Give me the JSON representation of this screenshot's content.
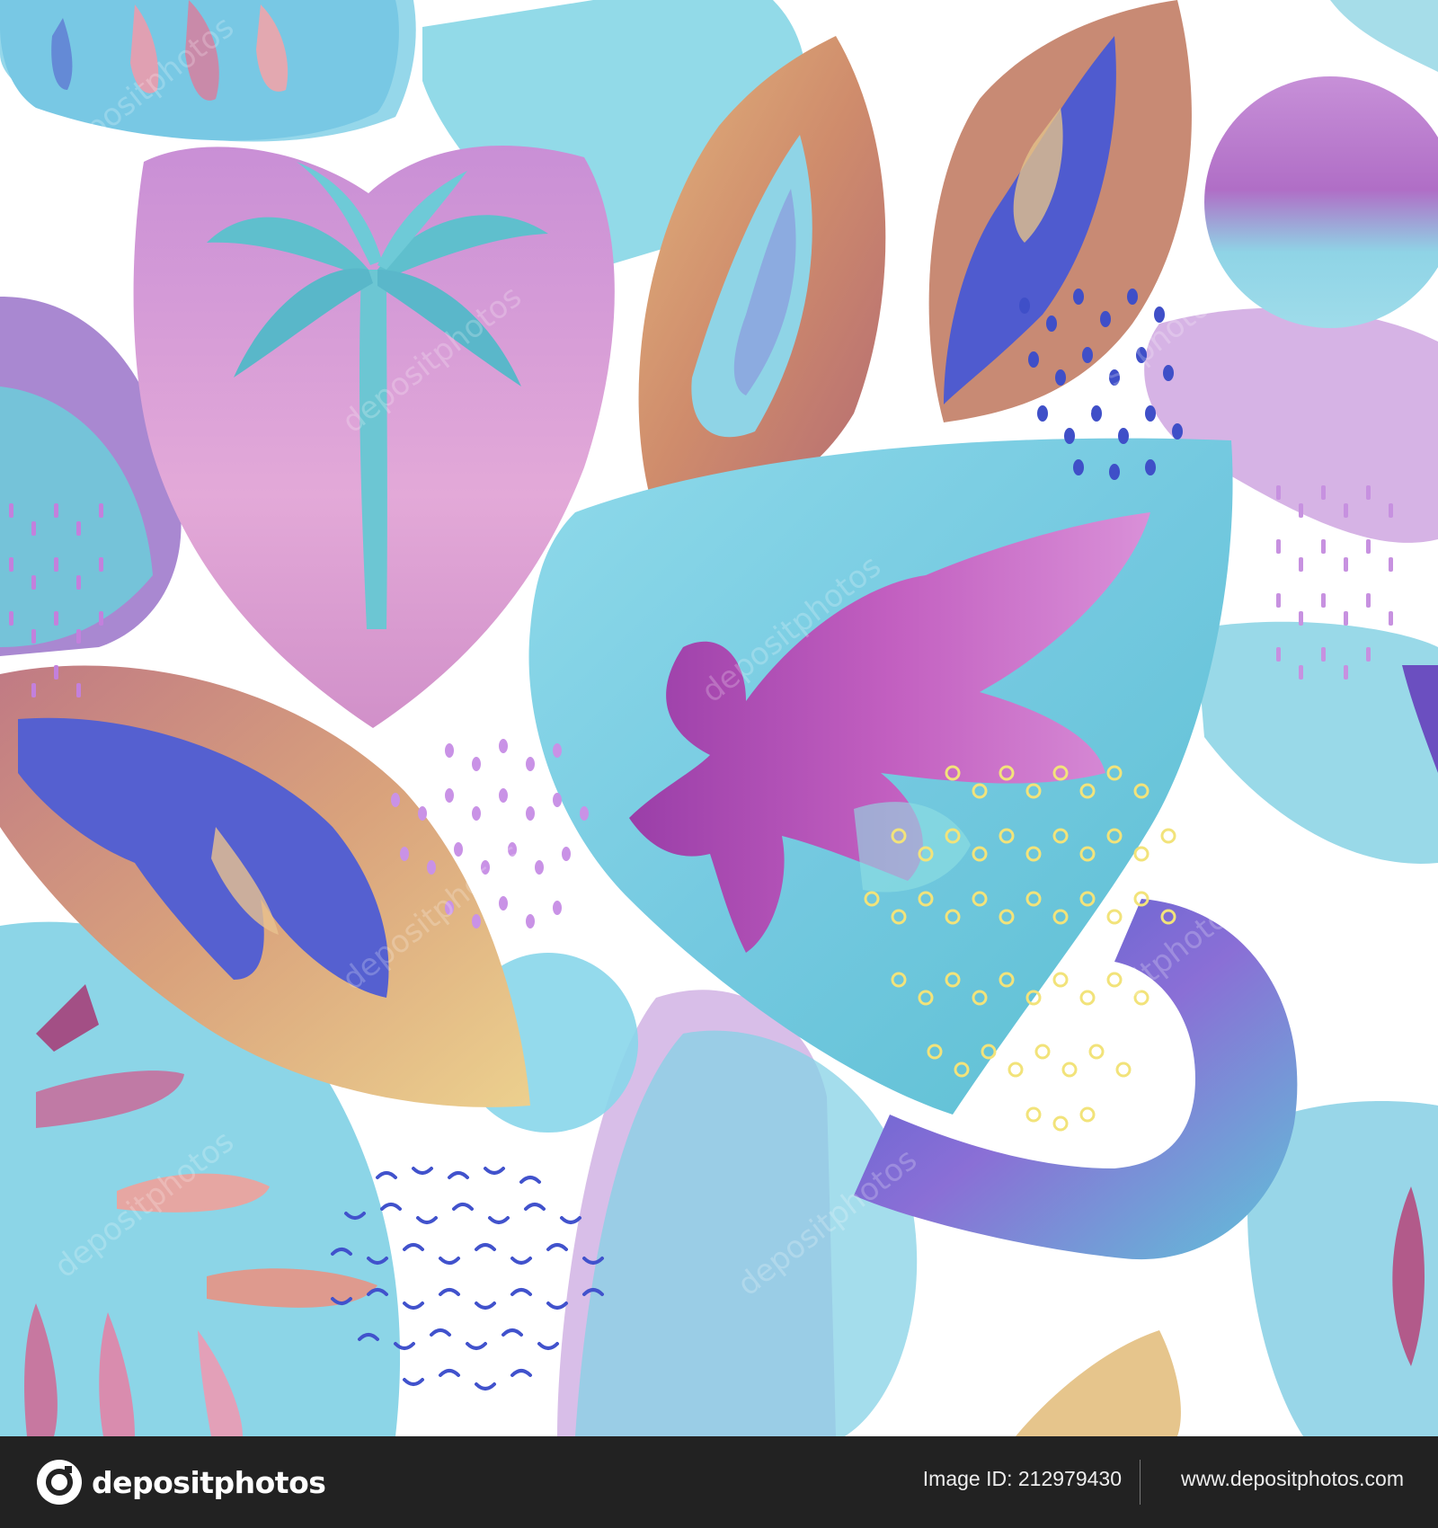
{
  "image": {
    "subject": "watercolor-tropical-leaf-pattern",
    "palette": {
      "turquoise": "#7fd3e6",
      "aqua": "#59c2d6",
      "violet": "#a35bc9",
      "indigo": "#4b57c6",
      "pink": "#d790c9",
      "peach": "#e3b28e",
      "ochre": "#e6c98c",
      "lilac": "#c9a0e3",
      "yellow": "#f4e884",
      "navy-dots": "#3f4fc8"
    }
  },
  "watermark": {
    "text": "depositphotos"
  },
  "footer": {
    "brand": "depositphotos",
    "image_id": "Image ID: 212979430",
    "site": "www.depositphotos.com"
  }
}
